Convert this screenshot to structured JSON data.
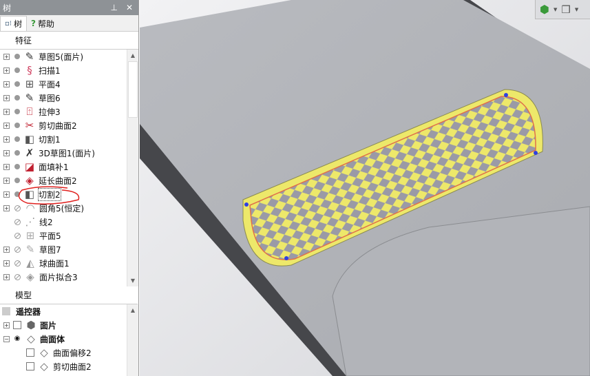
{
  "panel": {
    "title": "树",
    "pin_icon": "pin-icon",
    "close_icon": "close-icon",
    "tabs": [
      {
        "label": "树",
        "icon": "tree-icon",
        "active": true
      },
      {
        "label": "帮助",
        "icon": "help-icon",
        "active": false
      }
    ],
    "features_header": "特征",
    "features": [
      {
        "label": "草图5(面片)",
        "icon": "sketch-icon",
        "state": "active",
        "expand": true
      },
      {
        "label": "扫描1",
        "icon": "sweep-icon",
        "state": "active",
        "expand": true
      },
      {
        "label": "平面4",
        "icon": "plane-icon",
        "state": "active",
        "expand": true
      },
      {
        "label": "草图6",
        "icon": "sketch-icon",
        "state": "active",
        "expand": true
      },
      {
        "label": "拉伸3",
        "icon": "extrude-icon",
        "state": "active",
        "expand": true
      },
      {
        "label": "剪切曲面2",
        "icon": "trim-surface-icon",
        "state": "active",
        "expand": true
      },
      {
        "label": "切割1",
        "icon": "cut-icon",
        "state": "active",
        "expand": true
      },
      {
        "label": "3D草图1(面片)",
        "icon": "3d-sketch-icon",
        "state": "active",
        "expand": true
      },
      {
        "label": "面填补1",
        "icon": "fill-face-icon",
        "state": "active",
        "expand": true
      },
      {
        "label": "延长曲面2",
        "icon": "extend-surface-icon",
        "state": "active",
        "expand": true
      },
      {
        "label": "切割2",
        "icon": "cut-icon",
        "state": "active",
        "expand": true,
        "selected": true
      },
      {
        "label": "圆角5(恒定)",
        "icon": "fillet-icon",
        "state": "suppressed",
        "expand": true
      },
      {
        "label": "线2",
        "icon": "line-icon",
        "state": "suppressed",
        "expand": false
      },
      {
        "label": "平面5",
        "icon": "plane-icon",
        "state": "suppressed",
        "expand": false
      },
      {
        "label": "草图7",
        "icon": "sketch-icon",
        "state": "suppressed",
        "expand": true
      },
      {
        "label": "球曲面1",
        "icon": "sphere-surface-icon",
        "state": "suppressed",
        "expand": true
      },
      {
        "label": "面片拟合3",
        "icon": "mesh-fit-icon",
        "state": "suppressed",
        "expand": true
      }
    ],
    "model_header": "模型",
    "model": [
      {
        "label": "遥控器",
        "level": 0,
        "bold": true
      },
      {
        "label": "面片",
        "level": 0,
        "bold": true,
        "expand": "+"
      },
      {
        "label": "曲面体",
        "level": 0,
        "bold": true,
        "expand": "-"
      },
      {
        "label": "曲面偏移2",
        "level": 1
      },
      {
        "label": "剪切曲面2",
        "level": 1
      }
    ]
  },
  "colors": {
    "accent_yellow": "#ede86a",
    "body_gray": "#4a4b4f",
    "annotation_red": "#e0201e"
  }
}
